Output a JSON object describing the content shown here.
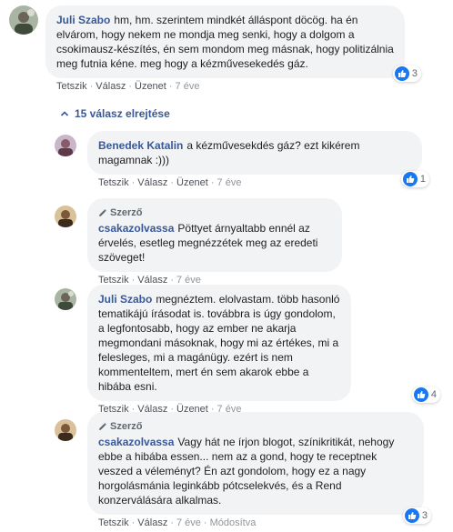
{
  "comments": [
    {
      "author": "Juli Szabo",
      "text": "hm, hm. szerintem mindkét álláspont döcög. ha én elvárom, hogy nekem ne mondja meg senki, hogy a dolgom a csokimausz-készítés, én sem mondom meg másnak, hogy politizálnia meg futnia kéne. meg hogy a kézművesekedés gáz.",
      "actions": {
        "like": "Tetszik",
        "reply": "Válasz",
        "message": "Üzenet",
        "time": "7 éve"
      },
      "reactions": "3"
    },
    {
      "author": "Benedek Katalin",
      "text": "a kézművesekdés gáz? ezt kikérem magamnak :)))",
      "actions": {
        "like": "Tetszik",
        "reply": "Válasz",
        "message": "Üzenet",
        "time": "7 éve"
      },
      "reactions": "1"
    },
    {
      "badge": "Szerző",
      "author": "csakazolvassa",
      "text": "Pöttyet árnyaltabb ennél az érvelés, esetleg megnézzétek meg az eredeti szöveget!",
      "actions": {
        "like": "Tetszik",
        "reply": "Válasz",
        "time": "7 éve"
      }
    },
    {
      "author": "Juli Szabo",
      "text": "megnéztem. elolvastam. több hasonló tematikájú írásodat is. továbbra is úgy gondolom, a legfontosabb, hogy az ember ne akarja megmondani másoknak, hogy mi az értékes, mi a felesleges, mi a magánügy. ezért is nem kommenteltem, mert én sem akarok ebbe a hibába esni.",
      "actions": {
        "like": "Tetszik",
        "reply": "Válasz",
        "message": "Üzenet",
        "time": "7 éve"
      },
      "reactions": "4"
    },
    {
      "badge": "Szerző",
      "author": "csakazolvassa",
      "text": "Vagy hát ne írjon blogot, színikritikát, nehogy ebbe a hibába essen... nem az a gond, hogy te receptnek veszed a véleményt? Én azt gondolom, hogy ez a nagy horgolásmánia leginkább pótcselekvés, és a Rend konzerválására alkalmas.",
      "actions": {
        "like": "Tetszik",
        "reply": "Válasz",
        "time": "7 éve",
        "edited": "Módosítva"
      },
      "reactions": "3"
    }
  ],
  "replies_toggle": "15 válasz elrejtése",
  "colors": {
    "link": "#385898",
    "bubble": "#f2f3f5",
    "like": "#1877f2"
  },
  "icons": {
    "like": "thumbs-up-icon",
    "pen": "pen-icon",
    "chevron": "chevron-up-icon"
  }
}
